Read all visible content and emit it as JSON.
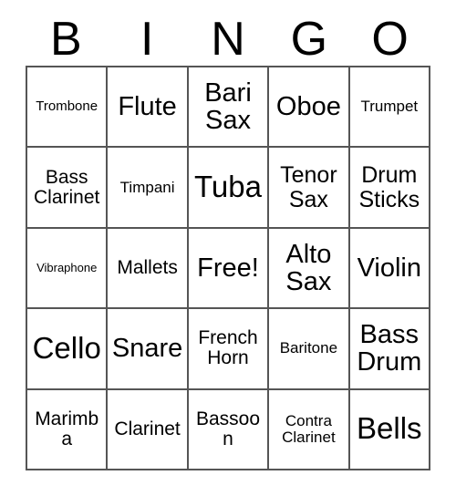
{
  "card": {
    "title": "Bingo Card",
    "header": {
      "letters": [
        "B",
        "I",
        "N",
        "G",
        "O"
      ]
    },
    "colors": {
      "background": "#ffffff",
      "cell_background": "#ffffff",
      "border": "#555555",
      "text": "#000000"
    },
    "grid": {
      "columns": 5,
      "rows": 5,
      "free_space": "Free!",
      "rows_data": [
        [
          {
            "label": "Trombone",
            "size": "s"
          },
          {
            "label": "Flute",
            "size": "xxl"
          },
          {
            "label": "Bari Sax",
            "size": "xxl"
          },
          {
            "label": "Oboe",
            "size": "xxl"
          },
          {
            "label": "Trumpet",
            "size": "m"
          }
        ],
        [
          {
            "label": "Bass Clarinet",
            "size": "l"
          },
          {
            "label": "Timpani",
            "size": "m"
          },
          {
            "label": "Tuba",
            "size": "xxxl"
          },
          {
            "label": "Tenor Sax",
            "size": "xl"
          },
          {
            "label": "Drum Sticks",
            "size": "xl"
          }
        ],
        [
          {
            "label": "Vibraphone",
            "size": "xs"
          },
          {
            "label": "Mallets",
            "size": "l"
          },
          {
            "label": "Free!",
            "size": "xxl"
          },
          {
            "label": "Alto Sax",
            "size": "xxl"
          },
          {
            "label": "Violin",
            "size": "xxl"
          }
        ],
        [
          {
            "label": "Cello",
            "size": "xxxl"
          },
          {
            "label": "Snare",
            "size": "xxl"
          },
          {
            "label": "French Horn",
            "size": "l"
          },
          {
            "label": "Baritone",
            "size": "m"
          },
          {
            "label": "Bass Drum",
            "size": "xxl"
          }
        ],
        [
          {
            "label": "Marimba",
            "size": "l"
          },
          {
            "label": "Clarinet",
            "size": "l"
          },
          {
            "label": "Bassoon",
            "size": "l"
          },
          {
            "label": "Contra Clarinet",
            "size": "m"
          },
          {
            "label": "Bells",
            "size": "xxxl"
          }
        ]
      ]
    }
  }
}
